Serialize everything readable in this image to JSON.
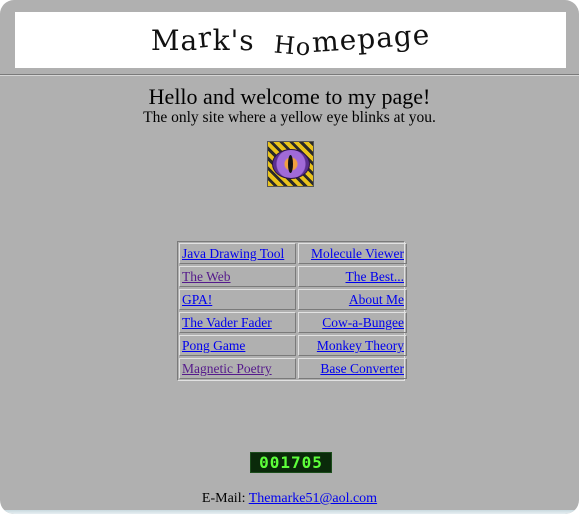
{
  "header": {
    "banner_parts": [
      "Ma",
      "r",
      "k's  ",
      "Ho",
      "mepage"
    ]
  },
  "intro": {
    "headline": "Hello and welcome to my page!",
    "subline": "The only site where a yellow eye blinks at you."
  },
  "icons": {
    "eye": "eye-icon"
  },
  "links": [
    {
      "label": "Java Drawing Tool",
      "align": "left"
    },
    {
      "label": "Molecule Viewer",
      "align": "right"
    },
    {
      "label": "The Web",
      "align": "left"
    },
    {
      "label": "The Best...",
      "align": "right"
    },
    {
      "label": "GPA!",
      "align": "left"
    },
    {
      "label": "About Me",
      "align": "right"
    },
    {
      "label": "The Vader Fader",
      "align": "left"
    },
    {
      "label": "Cow-a-Bungee",
      "align": "right"
    },
    {
      "label": "Pong Game",
      "align": "left"
    },
    {
      "label": "Monkey Theory",
      "align": "right"
    },
    {
      "label": "Magnetic Poetry",
      "align": "left"
    },
    {
      "label": "Base Converter",
      "align": "right"
    }
  ],
  "counter": {
    "value": "001705"
  },
  "footer": {
    "email_label": "E-Mail:",
    "email_address": "Themarke51@aol.com"
  },
  "colors": {
    "background": "#b0b0b0",
    "link": "#0000ee",
    "visited_link": "#551a8b",
    "counter_digits": "#5dff3a"
  }
}
